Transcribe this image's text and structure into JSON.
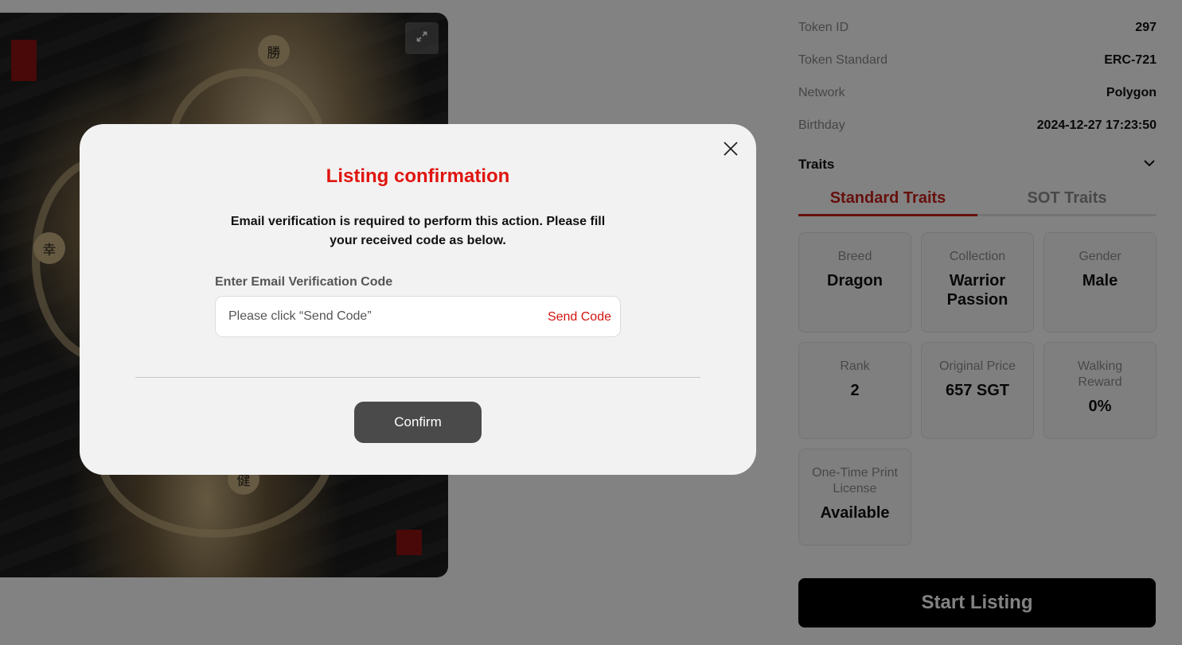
{
  "details": [
    {
      "key": "Token ID",
      "value": "297"
    },
    {
      "key": "Token Standard",
      "value": "ERC-721"
    },
    {
      "key": "Network",
      "value": "Polygon"
    },
    {
      "key": "Birthday",
      "value": "2024-12-27 17:23:50"
    }
  ],
  "traits": {
    "title": "Traits",
    "tabs": [
      "Standard Traits",
      "SOT Traits"
    ],
    "active_tab": "Standard Traits",
    "cards": [
      {
        "label": "Breed",
        "value": "Dragon"
      },
      {
        "label": "Collection",
        "value": "Warrior Passion"
      },
      {
        "label": "Gender",
        "value": "Male"
      },
      {
        "label": "Rank",
        "value": "2"
      },
      {
        "label": "Original Price",
        "value": "657 SGT"
      },
      {
        "label": "Walking Reward",
        "value": "0%"
      },
      {
        "label": "One-Time Print License",
        "value": "Available"
      }
    ]
  },
  "start_listing_label": "Start Listing",
  "artwork_glyphs": [
    "勝",
    "幸",
    "健"
  ],
  "modal": {
    "title": "Listing confirmation",
    "description": "Email verification is required to perform this action. Please fill your received code as below.",
    "field_label": "Enter Email Verification Code",
    "field_placeholder": "Please click “Send Code”",
    "field_value": "",
    "send_code_label": "Send Code",
    "confirm_label": "Confirm"
  },
  "colors": {
    "accent_red": "#e0150f",
    "tab_active": "#c8211a",
    "confirm_button": "#4a4a4a",
    "start_button": "#000000"
  },
  "icons": {
    "expand": "expand-icon",
    "close": "close-icon",
    "chevron": "chevron-down-icon"
  }
}
